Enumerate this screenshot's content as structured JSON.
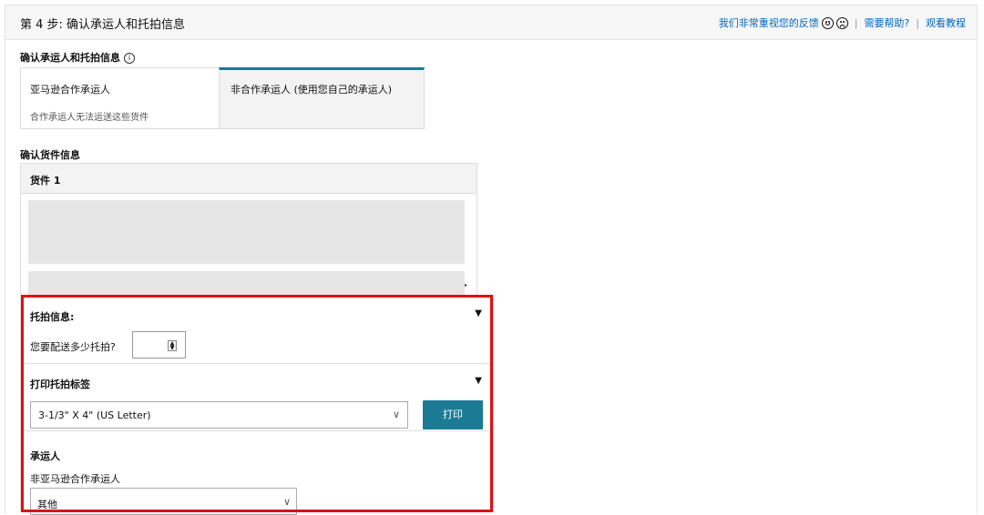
{
  "header": {
    "step_title": "第 4 步:   确认承运人和托拍信息",
    "feedback_label": "我们非常重视您的反馈",
    "help_label": "需要帮助?",
    "tutorial_label": "观看教程",
    "separator": "|"
  },
  "carrier_section": {
    "heading": "确认承运人和托拍信息",
    "info_icon": "i",
    "tabs": [
      {
        "label": "亚马逊合作承运人",
        "note": "合作承运人无法运送这些货件",
        "selected": false
      },
      {
        "label": "非合作承运人 (使用您自己的承运人)",
        "selected": true
      }
    ]
  },
  "shipment_section": {
    "heading": "确认货件信息",
    "shipment_title": "货件 1",
    "expand_arrow": "▸"
  },
  "pallet_panel": {
    "pallet_info_title": "托拍信息:",
    "quantity_question": "您要配送多少托拍?",
    "quantity_value": "",
    "label_title": "打印托拍标签",
    "label_size_selected": "3-1/3\" X 4\" (US Letter)",
    "print_label": "打印",
    "carrier_title": "承运人",
    "carrier_subtitle": "非亚马逊合作承运人",
    "carrier_selected": "其他",
    "collapse_glyph": "▼",
    "dropdown_glyph": "∨"
  },
  "colors": {
    "accent": "#1b7b95",
    "link": "#0066c0",
    "highlight": "#e01010"
  }
}
